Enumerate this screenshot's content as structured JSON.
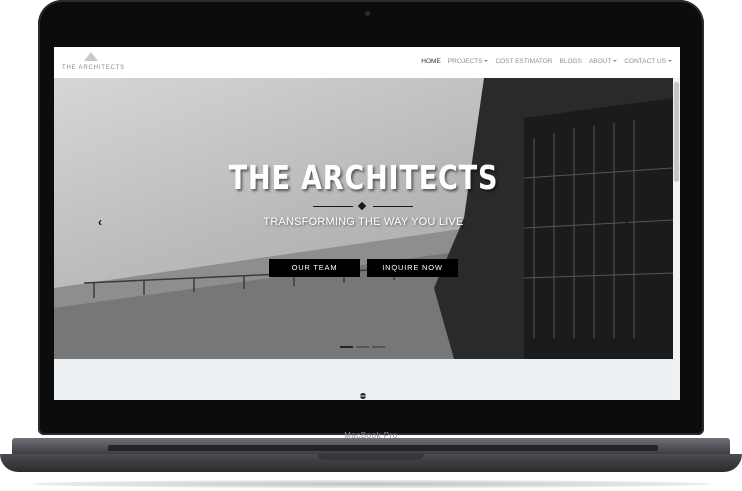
{
  "device": {
    "label": "MacBook Pro"
  },
  "navbar": {
    "logo_text": "THE ARCHITECTS",
    "items": [
      {
        "label": "HOME",
        "active": true,
        "dropdown": false
      },
      {
        "label": "PROJECTS",
        "active": false,
        "dropdown": true
      },
      {
        "label": "COST ESTIMATOR",
        "active": false,
        "dropdown": false
      },
      {
        "label": "BLOGS",
        "active": false,
        "dropdown": false
      },
      {
        "label": "ABOUT",
        "active": false,
        "dropdown": true
      },
      {
        "label": "CONTACT US",
        "active": false,
        "dropdown": true
      }
    ]
  },
  "hero": {
    "title": "THE ARCHITECTS",
    "tagline": "TRANSFORMING THE WAY YOU LIVE",
    "buttons": {
      "primary": "OUR TEAM",
      "secondary": "INQUIRE NOW"
    },
    "prev_icon": "‹",
    "next_icon": "›",
    "slide_count": 3,
    "active_slide": 1
  },
  "colors": {
    "accent": "#000000",
    "nav_text": "#8d8d8d",
    "below_bg": "#eceff2"
  }
}
